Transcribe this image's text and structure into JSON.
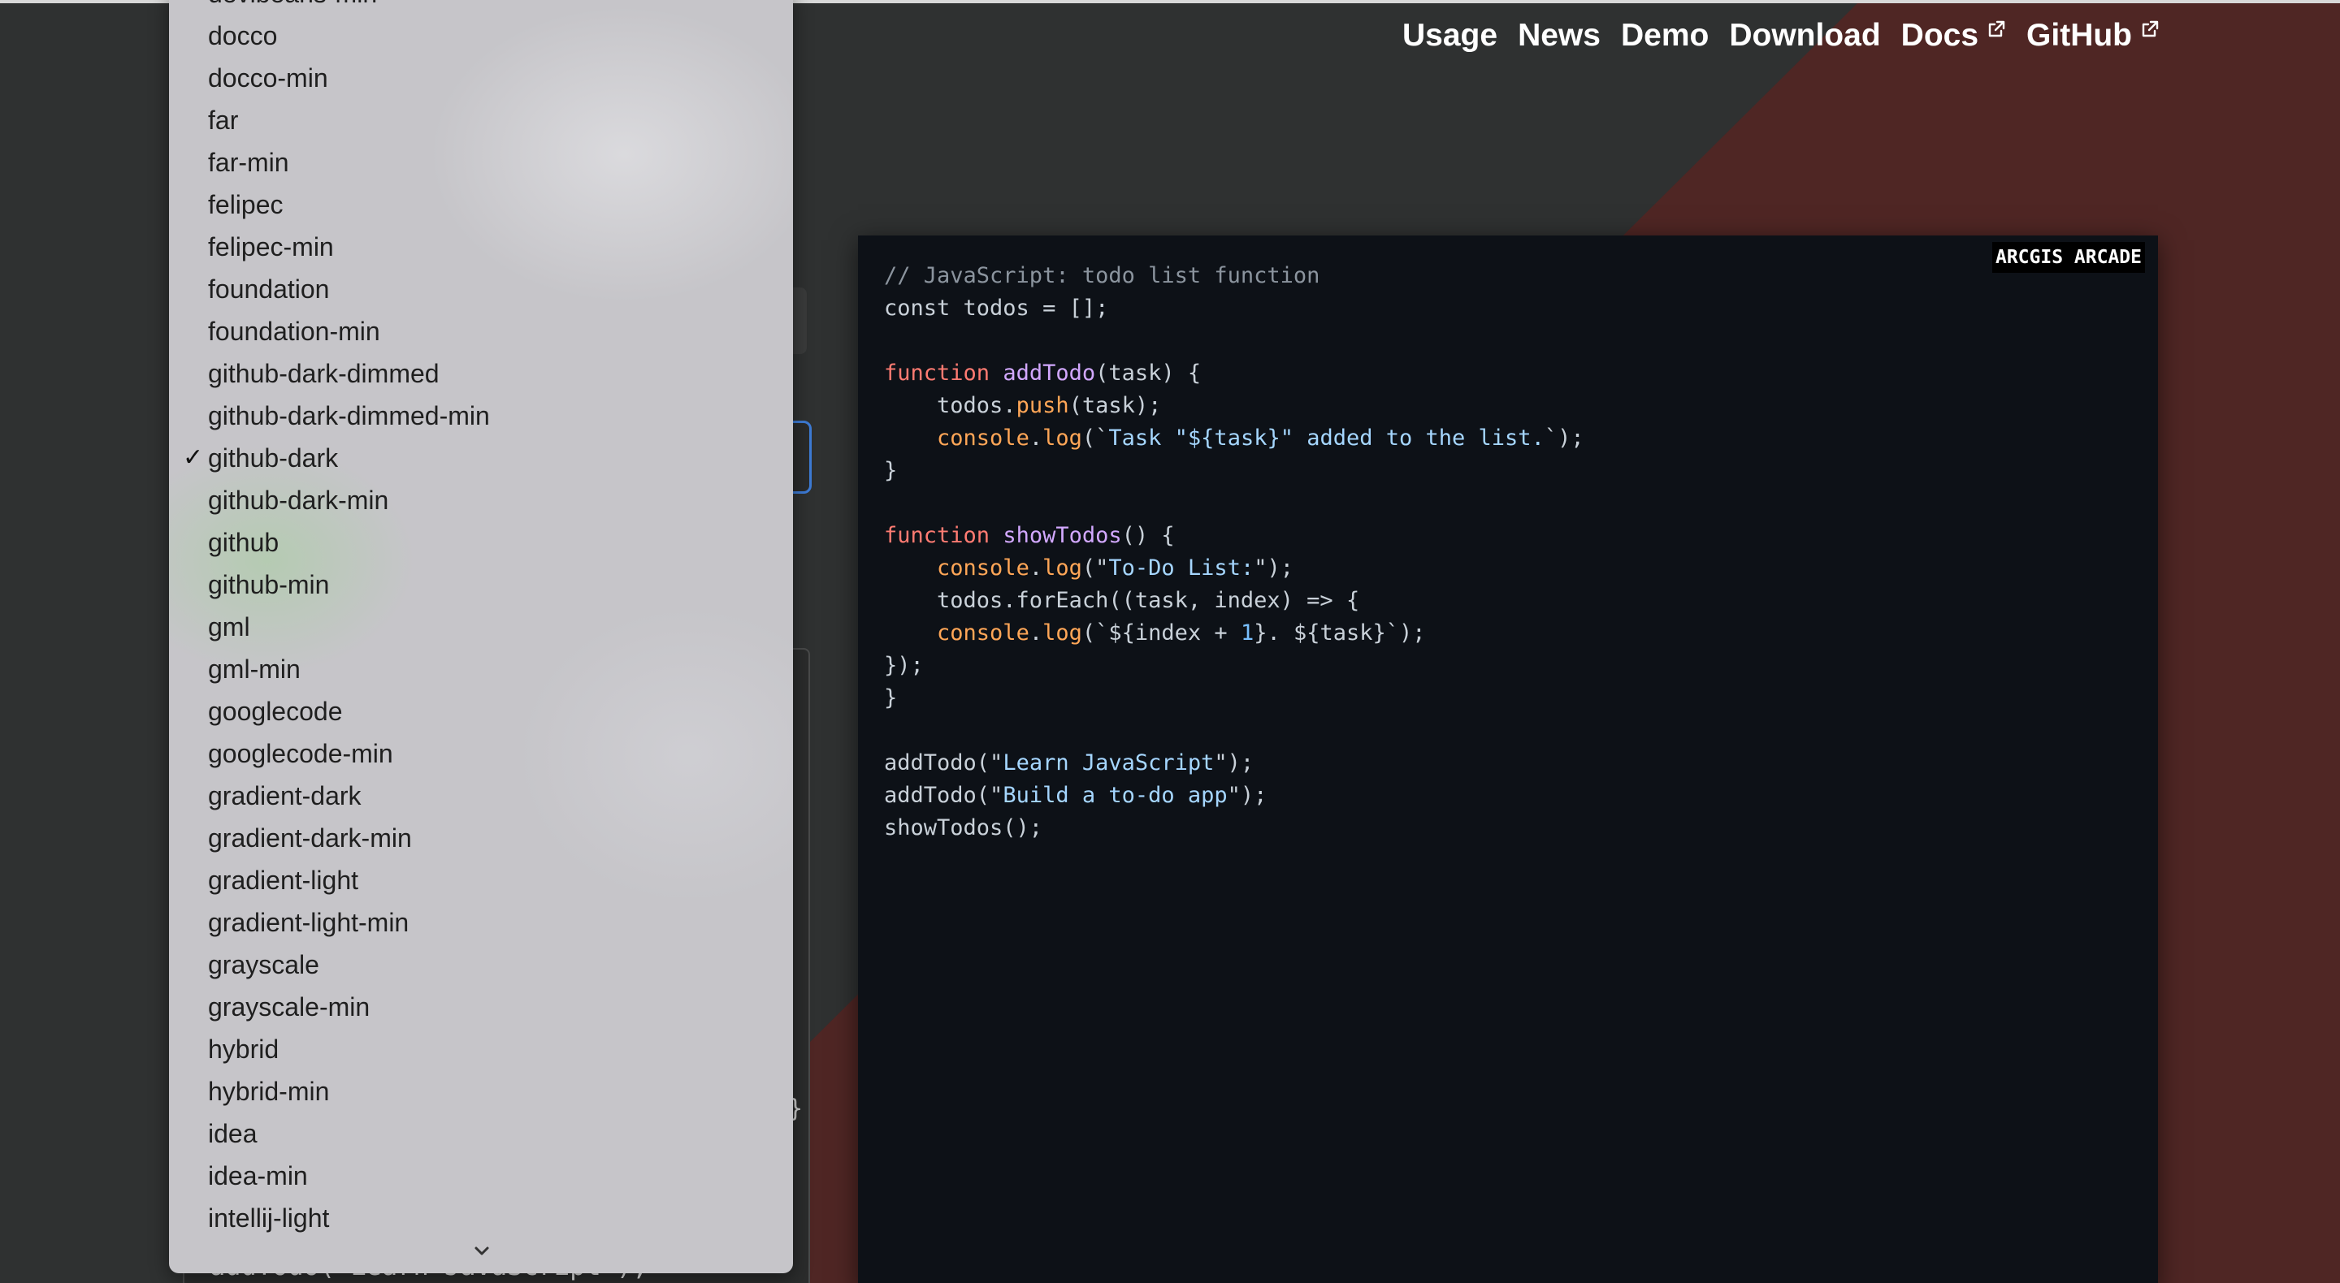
{
  "nav": {
    "items": [
      {
        "label": "Usage",
        "external": false
      },
      {
        "label": "News",
        "external": false
      },
      {
        "label": "Demo",
        "external": false
      },
      {
        "label": "Download",
        "external": false
      },
      {
        "label": "Docs",
        "external": true
      },
      {
        "label": "GitHub",
        "external": true
      }
    ]
  },
  "dropdown": {
    "options": [
      "devibeans-min",
      "docco",
      "docco-min",
      "far",
      "far-min",
      "felipec",
      "felipec-min",
      "foundation",
      "foundation-min",
      "github-dark-dimmed",
      "github-dark-dimmed-min",
      "github-dark",
      "github-dark-min",
      "github",
      "github-min",
      "gml",
      "gml-min",
      "googlecode",
      "googlecode-min",
      "gradient-dark",
      "gradient-dark-min",
      "gradient-light",
      "gradient-light-min",
      "grayscale",
      "grayscale-min",
      "hybrid",
      "hybrid-min",
      "idea",
      "idea-min",
      "intellij-light"
    ],
    "selected": "github-dark",
    "check_glyph": "✓"
  },
  "left_panel": {
    "brace": "}",
    "below_text": "addTodo(\"Learn JavaScript\");"
  },
  "code_panel": {
    "badge": "ARCGIS ARCADE",
    "lines": [
      [
        [
          "comment",
          "// JavaScript: todo list function"
        ]
      ],
      [
        [
          "plain",
          "const todos = [];"
        ]
      ],
      [],
      [
        [
          "keyword",
          "function "
        ],
        [
          "func",
          "addTodo"
        ],
        [
          "plain",
          "(task) {"
        ]
      ],
      [
        [
          "plain",
          "    todos."
        ],
        [
          "method",
          "push"
        ],
        [
          "plain",
          "(task);"
        ]
      ],
      [
        [
          "plain",
          "    "
        ],
        [
          "method",
          "console"
        ],
        [
          "plain",
          "."
        ],
        [
          "method",
          "log"
        ],
        [
          "plain",
          "(`"
        ],
        [
          "string",
          "Task \"${task}\" added to the list."
        ],
        [
          "plain",
          "`);"
        ]
      ],
      [
        [
          "plain",
          "}"
        ]
      ],
      [],
      [
        [
          "keyword",
          "function "
        ],
        [
          "func",
          "showTodos"
        ],
        [
          "plain",
          "() {"
        ]
      ],
      [
        [
          "plain",
          "    "
        ],
        [
          "method",
          "console"
        ],
        [
          "plain",
          "."
        ],
        [
          "method",
          "log"
        ],
        [
          "plain",
          "(\""
        ],
        [
          "string",
          "To-Do List:"
        ],
        [
          "plain",
          "\");"
        ]
      ],
      [
        [
          "plain",
          "    todos.forEach((task, index) => {"
        ]
      ],
      [
        [
          "plain",
          "    "
        ],
        [
          "method",
          "console"
        ],
        [
          "plain",
          "."
        ],
        [
          "method",
          "log"
        ],
        [
          "plain",
          "(`${index + "
        ],
        [
          "number",
          "1"
        ],
        [
          "plain",
          "}. ${task}`);"
        ]
      ],
      [
        [
          "plain",
          "});"
        ]
      ],
      [
        [
          "plain",
          "}"
        ]
      ],
      [],
      [
        [
          "plain",
          "addTodo(\""
        ],
        [
          "string",
          "Learn JavaScript"
        ],
        [
          "plain",
          "\");"
        ]
      ],
      [
        [
          "plain",
          "addTodo(\""
        ],
        [
          "string",
          "Build a to-do app"
        ],
        [
          "plain",
          "\");"
        ]
      ],
      [
        [
          "plain",
          "showTodos();"
        ]
      ]
    ]
  },
  "colors": {
    "background": "#2f3131",
    "accent_red": "#4f2624",
    "code_bg": "#0d1117",
    "dropdown_bg": "#c6c5c9",
    "focus_border": "#3d7bd6"
  }
}
